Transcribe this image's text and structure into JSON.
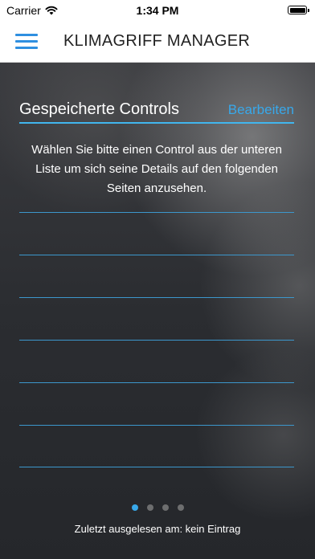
{
  "status_bar": {
    "carrier": "Carrier",
    "time": "1:34 PM"
  },
  "nav": {
    "title": "KLIMAGRIFF MANAGER"
  },
  "section": {
    "title": "Gespeicherte Controls",
    "edit_label": "Bearbeiten"
  },
  "instructions": "Wählen Sie bitte einen Control aus der unteren Liste um sich seine Details auf den folgenden Seiten anzusehen.",
  "controls_list": {
    "rows": [
      "",
      "",
      "",
      "",
      "",
      ""
    ]
  },
  "pager": {
    "total": 4,
    "active": 1
  },
  "footer": {
    "last_read": "Zuletzt ausgelesen am: kein Eintrag"
  },
  "colors": {
    "accent": "#38a8ea",
    "divider": "#3c97cc"
  },
  "icons": {
    "wifi": "wifi-icon",
    "battery": "battery-icon",
    "menu": "hamburger-menu-icon"
  }
}
